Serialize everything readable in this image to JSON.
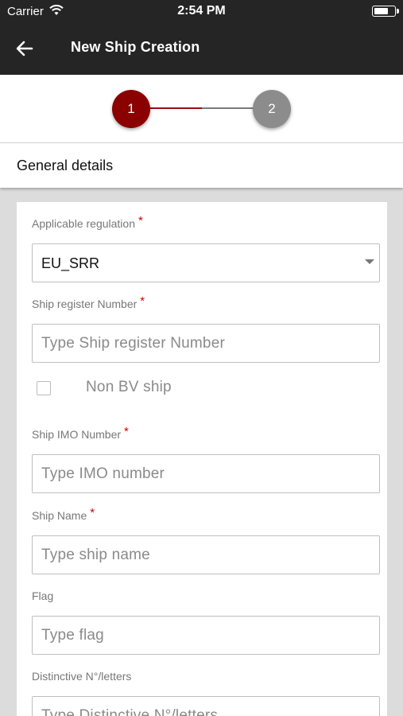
{
  "status_bar": {
    "carrier": "Carrier",
    "time": "2:54 PM",
    "battery_level": 0.75
  },
  "app_bar": {
    "title": "New Ship Creation"
  },
  "stepper": {
    "step1": "1",
    "step2": "2",
    "active_step": 1
  },
  "section": {
    "title": "General details"
  },
  "form": {
    "regulation": {
      "label": "Applicable regulation",
      "required": "*",
      "value": "EU_SRR"
    },
    "register_number": {
      "label": "Ship register Number",
      "required": "*",
      "placeholder": "Type Ship register Number"
    },
    "non_bv": {
      "label": "Non BV ship",
      "checked": false
    },
    "imo_number": {
      "label": "Ship IMO Number",
      "required": "*",
      "placeholder": "Type IMO number"
    },
    "ship_name": {
      "label": "Ship Name",
      "required": "*",
      "placeholder": "Type ship name"
    },
    "flag": {
      "label": "Flag",
      "placeholder": "Type flag"
    },
    "distinctive": {
      "label": "Distinctive N°/letters",
      "placeholder": "Type Distinctive N°/letters"
    }
  },
  "colors": {
    "app_bar": "#252525",
    "accent": "#8b0000",
    "inactive_step": "#8c8c8c",
    "required": "#d00000"
  },
  "icons": {
    "back": "arrow-left-icon",
    "wifi": "wifi-icon",
    "battery": "battery-icon"
  }
}
